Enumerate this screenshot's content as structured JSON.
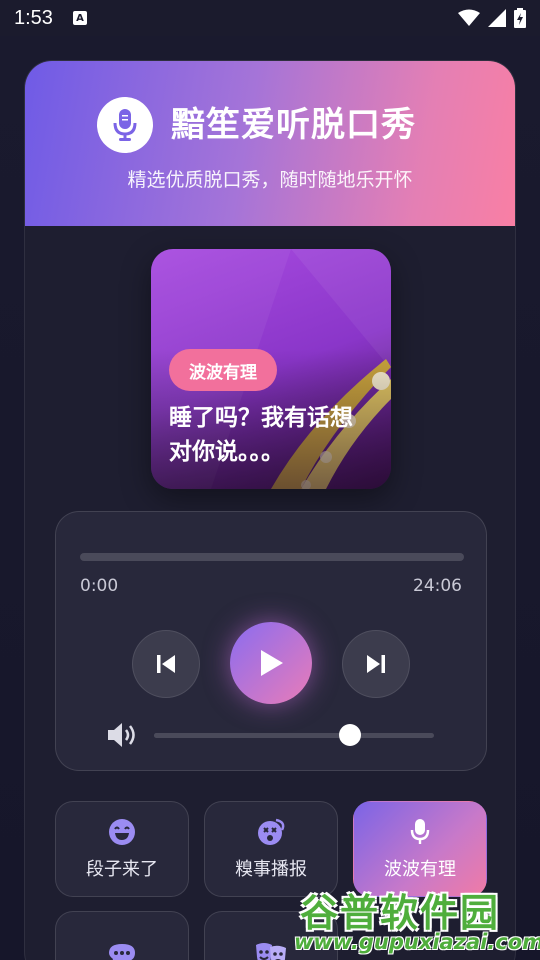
{
  "status_bar": {
    "time": "1:53",
    "notification_icon": "A",
    "icons": [
      "wifi-icon",
      "signal-icon",
      "battery-icon"
    ]
  },
  "header": {
    "title": "黯笙爱听脱口秀",
    "subtitle": "精选优质脱口秀，随时随地乐开怀",
    "logo_icon": "microphone-icon"
  },
  "album": {
    "tag": "波波有理",
    "title": "睡了吗？我有话想对你说。。。"
  },
  "player": {
    "current_time": "0:00",
    "duration": "24:06",
    "progress": 0.0,
    "volume": 0.7,
    "controls": [
      "skip-previous-icon",
      "play-icon",
      "skip-next-icon"
    ]
  },
  "categories": [
    {
      "label": "段子来了",
      "icon": "laugh-icon",
      "active": false
    },
    {
      "label": "糗事播报",
      "icon": "dizzy-face-icon",
      "active": false
    },
    {
      "label": "波波有理",
      "icon": "microphone-icon",
      "active": true
    },
    {
      "label": "",
      "icon": "chat-bubble-icon",
      "active": false
    },
    {
      "label": "",
      "icon": "theater-masks-icon",
      "active": false
    }
  ],
  "watermark": {
    "brand": "谷普软件园",
    "url": "www.gupuxiazai.com"
  },
  "colors": {
    "accent_purple": "#7b64e6",
    "accent_pink": "#f2709c",
    "card_bg": "#1e1e30",
    "panel_bg": "#28283b"
  }
}
